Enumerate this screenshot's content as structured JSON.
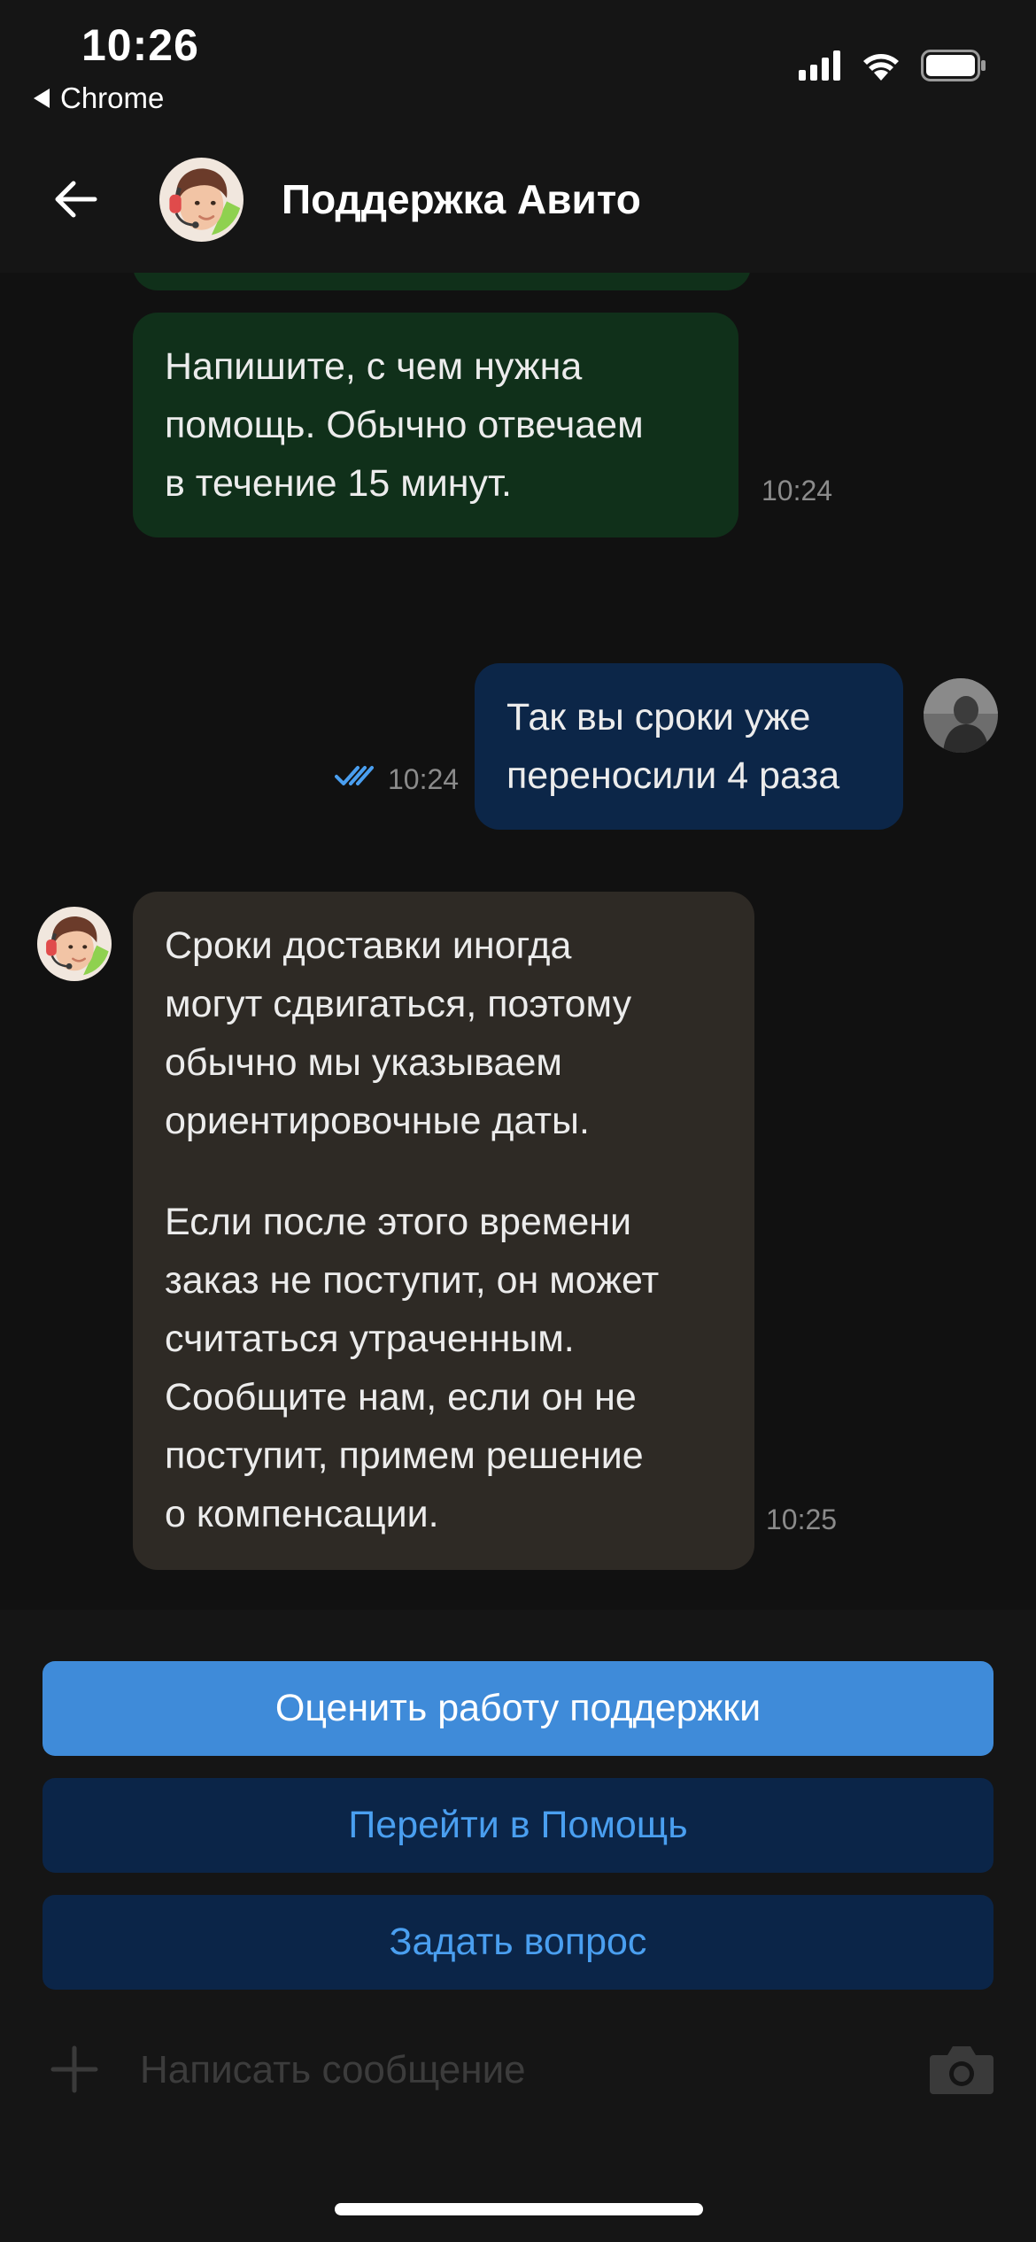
{
  "status_bar": {
    "time": "10:26",
    "back_app": "Chrome"
  },
  "header": {
    "title": "Поддержка Авито"
  },
  "messages": [
    {
      "from": "support",
      "lines": [
        "Напишите, с чем нужна",
        "помощь. Обычно отвечаем",
        "в течение 15 минут."
      ],
      "time": "10:24"
    },
    {
      "from": "user",
      "lines": [
        "Так вы сроки уже",
        "переносили 4 раза"
      ],
      "time": "10:24",
      "status": "read"
    },
    {
      "from": "support",
      "paragraph1": [
        "Сроки доставки иногда",
        "могут сдвигаться, поэтому",
        "обычно мы указываем",
        "ориентировочные даты."
      ],
      "paragraph2": [
        "Если после этого времени",
        "заказ не поступит, он может",
        "считаться утраченным.",
        "Сообщите нам, если он не",
        "поступит, примем решение",
        "о компенсации."
      ],
      "time": "10:25"
    }
  ],
  "actions": {
    "rate_label": "Оценить работу поддержки",
    "help_label": "Перейти в Помощь",
    "ask_label": "Задать вопрос"
  },
  "composer": {
    "placeholder": "Написать сообщение"
  },
  "colors": {
    "support_bubble_first": "#10301a",
    "user_bubble": "#0c2648",
    "support_bubble": "#2e2a25",
    "primary_button": "#3f8bd9",
    "secondary_button": "#0b2548",
    "secondary_button_text": "#4a9ff0",
    "read_ticks": "#4a9ff0"
  },
  "icons": {
    "back": "arrow-left-icon",
    "attach": "plus-icon",
    "camera": "camera-icon",
    "read_status": "double-check-icon"
  }
}
